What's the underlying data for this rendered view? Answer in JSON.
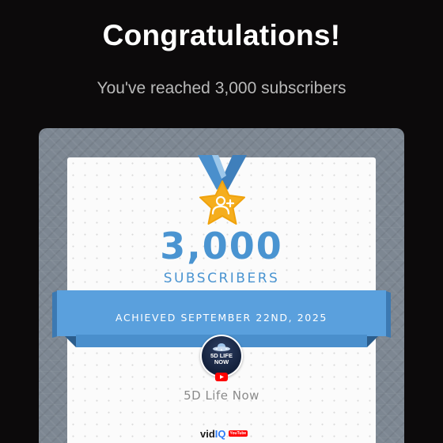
{
  "heading": "Congratulations!",
  "subheading": "You've reached 3,000 subscribers",
  "milestone": {
    "count": "3,000",
    "count_label": "SUBSCRIBERS",
    "icon": "star-add-person-icon"
  },
  "banner": {
    "text": "ACHIEVED SEPTEMBER 22ND, 2025"
  },
  "channel": {
    "badge_text": "5D LIFE\nNOW",
    "name": "5D Life Now",
    "platform_icon": "youtube-icon"
  },
  "brand": {
    "name_prefix": "vid",
    "name_accent": "IQ",
    "platform": "YouTube"
  },
  "colors": {
    "background": "#0c0a0b",
    "accent_blue": "#4a94d1",
    "star_gold": "#f5ae1e",
    "youtube_red": "#ff0000"
  }
}
